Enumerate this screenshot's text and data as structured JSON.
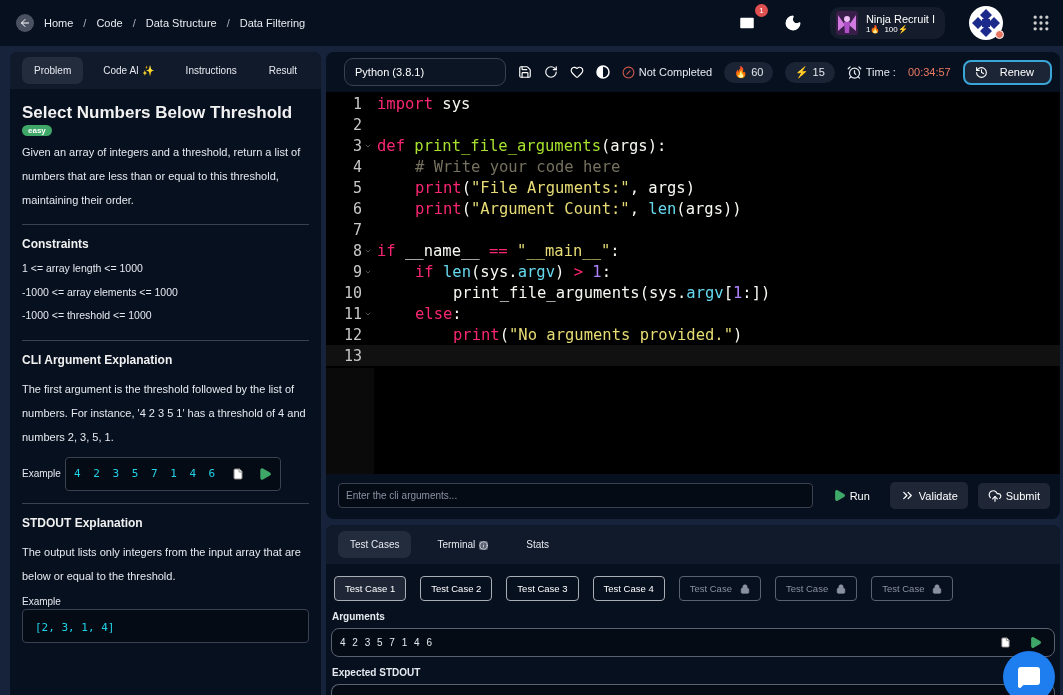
{
  "breadcrumb": [
    "Home",
    "Code",
    "Data Structure",
    "Data Filtering"
  ],
  "breadcrumb_separator": "/",
  "header": {
    "mail_count": "1",
    "rank_title": "Ninja Recruit I",
    "rank_streak": "1🔥",
    "rank_points": "100⚡",
    "avatar_online": true
  },
  "left_tabs": [
    {
      "label": "Problem",
      "selected": true
    },
    {
      "label": "Code AI ✨",
      "selected": false
    },
    {
      "label": "Instructions",
      "selected": false
    },
    {
      "label": "Result",
      "selected": false
    }
  ],
  "problem": {
    "title": "Select Numbers Below Threshold",
    "difficulty": "easy",
    "description": "Given an array of integers and a threshold, return a list of numbers that are less than or equal to this threshold, maintaining their order.",
    "constraints_title": "Constraints",
    "constraints": [
      "1 <= array length <= 1000",
      "-1000 <= array elements <= 1000",
      "-1000 <= threshold <= 1000"
    ],
    "cli_title": "CLI Argument Explanation",
    "cli_text": "The first argument is the threshold followed by the list of numbers. For instance, '4 2 3 5 1' has a threshold of 4 and numbers 2, 3, 5, 1.",
    "cli_example_label": "Example",
    "cli_example": "4 2 3 5 7 1 4 6",
    "stdout_title": "STDOUT Explanation",
    "stdout_text": "The output lists only integers from the input array that are below or equal to the threshold.",
    "stdout_example_label": "Example",
    "stdout_example": "[2, 3, 1, 4]"
  },
  "toolbar": {
    "language": "Python (3.8.1)",
    "status": "Not Completed",
    "fire": "🔥 60",
    "bolt": "⚡ 15",
    "time_label": "Time :",
    "time": "00:34:57",
    "renew": "Renew"
  },
  "code": [
    {
      "number": "1",
      "fold": false,
      "tokens": [
        {
          "kind": "keyword",
          "text": "import "
        },
        {
          "kind": "plain",
          "text": "sys"
        }
      ]
    },
    {
      "number": "2",
      "fold": false
    },
    {
      "number": "3",
      "fold": true,
      "tokens": [
        {
          "kind": "keyword",
          "text": "def "
        },
        {
          "kind": "function",
          "text": "print_file_arguments"
        },
        {
          "kind": "plain",
          "text": "(args):"
        }
      ],
      "children": [
        {
          "number": "4",
          "fold": false,
          "tokens": [
            {
              "kind": "comment",
              "text": "# Write your code here"
            }
          ]
        },
        {
          "number": "5",
          "fold": false,
          "tokens": [
            {
              "kind": "keyword",
              "text": "print"
            },
            {
              "kind": "plain",
              "text": "("
            },
            {
              "kind": "string",
              "text": "\"File Arguments:\""
            },
            {
              "kind": "plain",
              "text": ", args)"
            }
          ]
        },
        {
          "number": "6",
          "fold": false,
          "tokens": [
            {
              "kind": "keyword",
              "text": "print"
            },
            {
              "kind": "plain",
              "text": "("
            },
            {
              "kind": "string",
              "text": "\"Argument Count:\""
            },
            {
              "kind": "plain",
              "text": ", "
            },
            {
              "kind": "builtin",
              "text": "len"
            },
            {
              "kind": "plain",
              "text": "(args))"
            }
          ]
        }
      ]
    },
    {
      "number": "7",
      "fold": false
    },
    {
      "number": "8",
      "fold": true,
      "tokens": [
        {
          "kind": "keyword",
          "text": "if "
        },
        {
          "kind": "plain",
          "text": "__name__ "
        },
        {
          "kind": "keyword",
          "text": "== "
        },
        {
          "kind": "string",
          "text": "\"__main__\""
        },
        {
          "kind": "plain",
          "text": ":"
        }
      ],
      "children": [
        {
          "number": "9",
          "fold": true,
          "tokens": [
            {
              "kind": "keyword",
              "text": "if "
            },
            {
              "kind": "builtin",
              "text": "len"
            },
            {
              "kind": "plain",
              "text": "(sys."
            },
            {
              "kind": "builtin",
              "text": "argv"
            },
            {
              "kind": "plain",
              "text": ") "
            },
            {
              "kind": "keyword",
              "text": "> "
            },
            {
              "kind": "number",
              "text": "1"
            },
            {
              "kind": "plain",
              "text": ":"
            }
          ],
          "children": [
            {
              "number": "10",
              "fold": false,
              "tokens": [
                {
                  "kind": "plain",
                  "text": "print_file_arguments(sys."
                },
                {
                  "kind": "builtin",
                  "text": "argv"
                },
                {
                  "kind": "plain",
                  "text": "["
                },
                {
                  "kind": "number",
                  "text": "1"
                },
                {
                  "kind": "plain",
                  "text": ":])"
                }
              ]
            }
          ]
        },
        {
          "number": "11",
          "fold": true,
          "tokens": [
            {
              "kind": "keyword",
              "text": "else"
            },
            {
              "kind": "plain",
              "text": ":"
            }
          ],
          "children": [
            {
              "number": "12",
              "fold": false,
              "tokens": [
                {
                  "kind": "keyword",
                  "text": "print"
                },
                {
                  "kind": "plain",
                  "text": "("
                },
                {
                  "kind": "string",
                  "text": "\"No arguments provided.\""
                },
                {
                  "kind": "plain",
                  "text": ")"
                }
              ]
            }
          ]
        }
      ]
    },
    {
      "number": "13",
      "fold": false
    }
  ],
  "cli": {
    "placeholder": "Enter the cli arguments...",
    "buttons": [
      {
        "kind": "run",
        "label": "Run"
      },
      {
        "kind": "validate",
        "label": "Validate"
      },
      {
        "kind": "submit",
        "label": "Submit"
      }
    ]
  },
  "bottom_tabs": [
    {
      "label": "Test Cases",
      "selected": true,
      "info": false
    },
    {
      "label": "Terminal",
      "selected": false,
      "info": true
    },
    {
      "label": "Stats",
      "selected": false,
      "info": false
    }
  ],
  "test_cases": [
    {
      "label": "Test Case 1",
      "selected": true,
      "locked": false
    },
    {
      "label": "Test Case 2",
      "selected": false,
      "locked": false
    },
    {
      "label": "Test Case 3",
      "selected": false,
      "locked": false
    },
    {
      "label": "Test Case 4",
      "selected": false,
      "locked": false
    },
    {
      "label": "Test Case",
      "selected": false,
      "locked": true
    },
    {
      "label": "Test Case",
      "selected": false,
      "locked": true
    },
    {
      "label": "Test Case",
      "selected": false,
      "locked": true
    }
  ],
  "arguments_label": "Arguments",
  "arguments": "4 2 3 5 7 1 4 6",
  "expected_label": "Expected STDOUT"
}
